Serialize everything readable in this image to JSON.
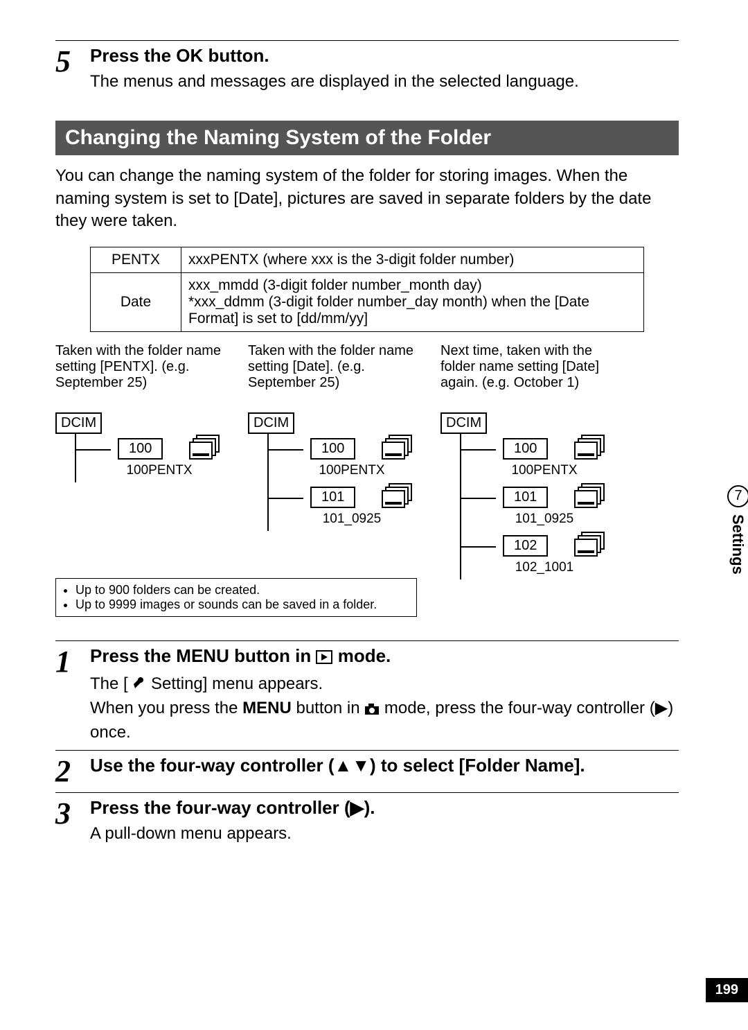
{
  "step5": {
    "num": "5",
    "title_before": "Press the ",
    "title_ok": "OK",
    "title_after": " button.",
    "desc": "The menus and messages are displayed in the selected language."
  },
  "section_title": "Changing the Naming System of the Folder",
  "intro": "You can change the naming system of the folder for storing images. When the naming system is set to [Date], pictures are saved in separate folders by the date they were taken.",
  "naming_table": {
    "r1k": "PENTX",
    "r1v": "xxxPENTX (where xxx is the 3-digit folder number)",
    "r2k": "Date",
    "r2v1": "xxx_mmdd (3-digit folder number_month day)",
    "r2v2": "*xxx_ddmm (3-digit folder number_day month) when the [Date Format] is set to [dd/mm/yy]"
  },
  "diagrams": {
    "col1": {
      "caption": "Taken with the folder name setting [PENTX]. (e.g. September 25)",
      "dcim": "DCIM",
      "rows": [
        {
          "box": "100",
          "label": "100PENTX"
        }
      ]
    },
    "col2": {
      "caption": "Taken with the folder name setting [Date]. (e.g. September 25)",
      "dcim": "DCIM",
      "rows": [
        {
          "box": "100",
          "label": "100PENTX"
        },
        {
          "box": "101",
          "label": "101_0925"
        }
      ]
    },
    "col3": {
      "caption": "Next time, taken with the folder name setting [Date] again. (e.g. October 1)",
      "dcim": "DCIM",
      "rows": [
        {
          "box": "100",
          "label": "100PENTX"
        },
        {
          "box": "101",
          "label": "101_0925"
        },
        {
          "box": "102",
          "label": "102_1001"
        }
      ]
    }
  },
  "notes": [
    "Up to 900 folders can be created.",
    "Up to 9999 images or sounds can be saved in a folder."
  ],
  "steps": {
    "s1": {
      "num": "1",
      "title_a": "Press the ",
      "title_menu": "MENU",
      "title_b": " button in ",
      "title_c": " mode.",
      "desc_a": "The [",
      "desc_b": " Setting] menu appears.",
      "desc_c": "When you press the ",
      "desc_menu": "MENU",
      "desc_d": " button in ",
      "desc_e": " mode, press the four-way controller (",
      "desc_f": ") once."
    },
    "s2": {
      "num": "2",
      "title": "Use the four-way controller (▲▼) to select [Folder Name]."
    },
    "s3": {
      "num": "3",
      "title": "Press the four-way controller (▶).",
      "desc": "A pull-down menu appears."
    }
  },
  "side": {
    "chapter": "7",
    "label": "Settings"
  },
  "page_number": "199"
}
